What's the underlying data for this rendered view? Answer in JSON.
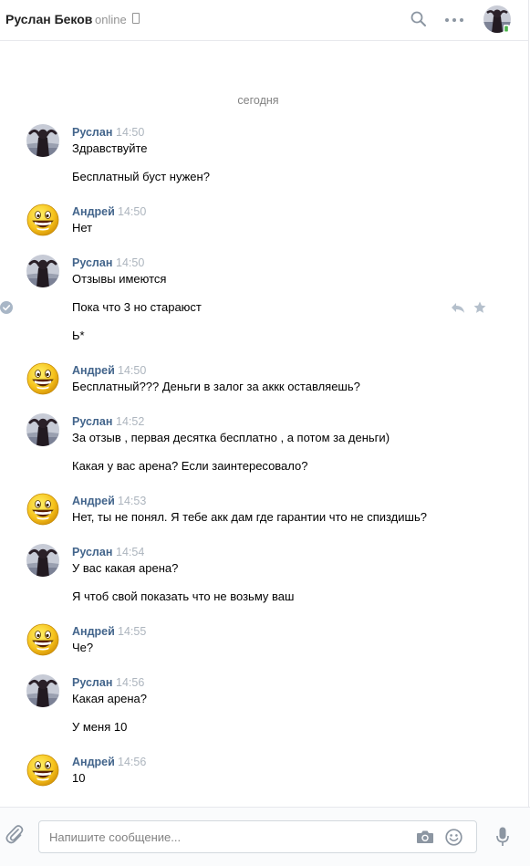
{
  "header": {
    "name": "Руслан Беков",
    "status": "online"
  },
  "date_separator": "сегодня",
  "messages": [
    {
      "author": "Руслан",
      "time": "14:50",
      "lines": [
        "Здравствуйте",
        "Бесплатный буст нужен?"
      ]
    },
    {
      "author": "Андрей",
      "time": "14:50",
      "lines": [
        "Нет"
      ]
    },
    {
      "author": "Руслан",
      "time": "14:50",
      "lines": [
        "Отзывы имеются",
        "Пока что 3 но стараюст",
        "Ь*"
      ]
    },
    {
      "author": "Андрей",
      "time": "14:50",
      "lines": [
        "Бесплатный??? Деньги в залог за аккк оставляешь?"
      ]
    },
    {
      "author": "Руслан",
      "time": "14:52",
      "lines": [
        "За отзыв , первая десятка бесплатно , а потом за деньги)",
        "Какая у вас арена? Если заинтересовало?"
      ]
    },
    {
      "author": "Андрей",
      "time": "14:53",
      "lines": [
        "Нет, ты не понял. Я тебе акк дам где гарантии что не спиздишь?"
      ]
    },
    {
      "author": "Руслан",
      "time": "14:54",
      "lines": [
        "У вас какая арена?",
        "Я чтоб свой показать что не возьму ваш"
      ]
    },
    {
      "author": "Андрей",
      "time": "14:55",
      "lines": [
        "Че?"
      ]
    },
    {
      "author": "Руслан",
      "time": "14:56",
      "lines": [
        "Какая арена?",
        "У меня 10"
      ]
    },
    {
      "author": "Андрей",
      "time": "14:56",
      "lines": [
        "10"
      ]
    }
  ],
  "composer": {
    "placeholder": "Напишите сообщение..."
  },
  "icons": {
    "search": "search-icon",
    "more": "more-icon",
    "attach": "paperclip-icon",
    "camera": "camera-icon",
    "emoji": "smile-icon",
    "mic": "microphone-icon",
    "reply": "reply-icon",
    "star": "star-icon",
    "check": "check-icon"
  },
  "colors": {
    "author": "#42648b",
    "accent": "#5181b8",
    "muted": "#939393"
  }
}
